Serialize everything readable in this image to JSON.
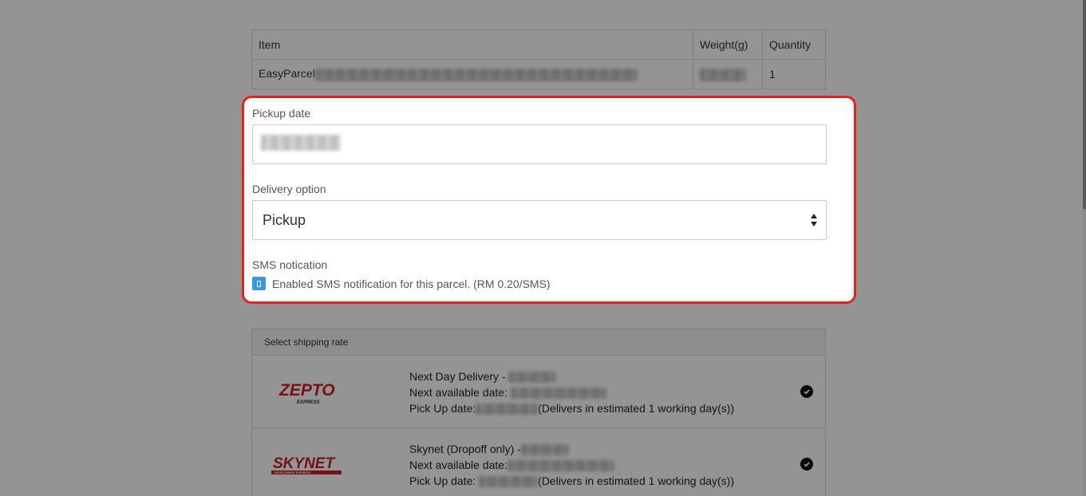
{
  "item_table": {
    "headers": {
      "item": "Item",
      "weight": "Weight(g)",
      "quantity": "Quantity"
    },
    "row": {
      "item_name": "EasyParcel",
      "quantity": "1"
    }
  },
  "form": {
    "pickup_date_label": "Pickup date",
    "delivery_option_label": "Delivery option",
    "delivery_option_value": "Pickup",
    "sms_label": "SMS notication",
    "sms_checkbox_text": "Enabled SMS notification for this parcel. (RM 0.20/SMS)",
    "highlight_color": "#e0241b",
    "checkbox_color": "#3a9ad9"
  },
  "shipping": {
    "header": "Select shipping rate",
    "rates": [
      {
        "logo_text": "ZEPTO",
        "logo_subtext": "EXPRESS",
        "service": "Next Day Delivery -",
        "next_available_label": "Next available date:",
        "pickup_label": "Pick Up date:",
        "estimate": "(Delivers in estimated 1 working day(s))",
        "logo_color": "#cc1f24"
      },
      {
        "logo_text": "SKYNET",
        "logo_subtext": "WORLDWIDE EXPRESS",
        "service": "Skynet (Dropoff only) -",
        "next_available_label": "Next available date:",
        "pickup_label": "Pick Up date:",
        "estimate": "(Delivers in estimated 1 working day(s))",
        "logo_color": "#cc1f24"
      }
    ]
  }
}
